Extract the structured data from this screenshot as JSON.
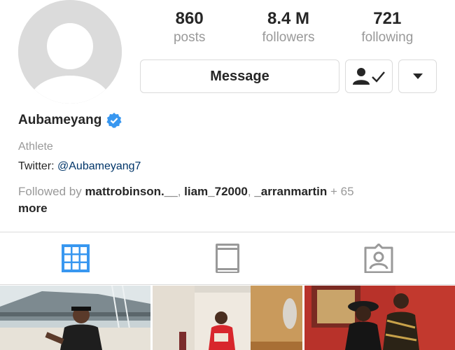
{
  "profile": {
    "username": "Aubameyang",
    "category": "Athlete",
    "bio_prefix": "Twitter: ",
    "bio_link": "@Aubameyang7",
    "verified_icon": "verified-badge-icon"
  },
  "stats": {
    "posts_count": "860",
    "posts_label": "posts",
    "followers_count": "8.4 M",
    "followers_label": "followers",
    "following_count": "721",
    "following_label": "following"
  },
  "actions": {
    "message_label": "Message",
    "following_icon": "person-check-icon",
    "more_icon": "caret-down-icon"
  },
  "followed_by": {
    "prefix": "Followed by ",
    "users": [
      "mattrobinson.__",
      "liam_72000",
      "_arranmartin"
    ],
    "suffix_count": "+ 65",
    "suffix_more": "more"
  },
  "tabs": [
    {
      "icon": "grid-icon",
      "active": true
    },
    {
      "icon": "feed-icon",
      "active": false
    },
    {
      "icon": "tagged-icon",
      "active": false
    }
  ],
  "colors": {
    "accent": "#3897f0",
    "text": "#262626",
    "muted": "#999999",
    "border": "#dbdbdb"
  }
}
